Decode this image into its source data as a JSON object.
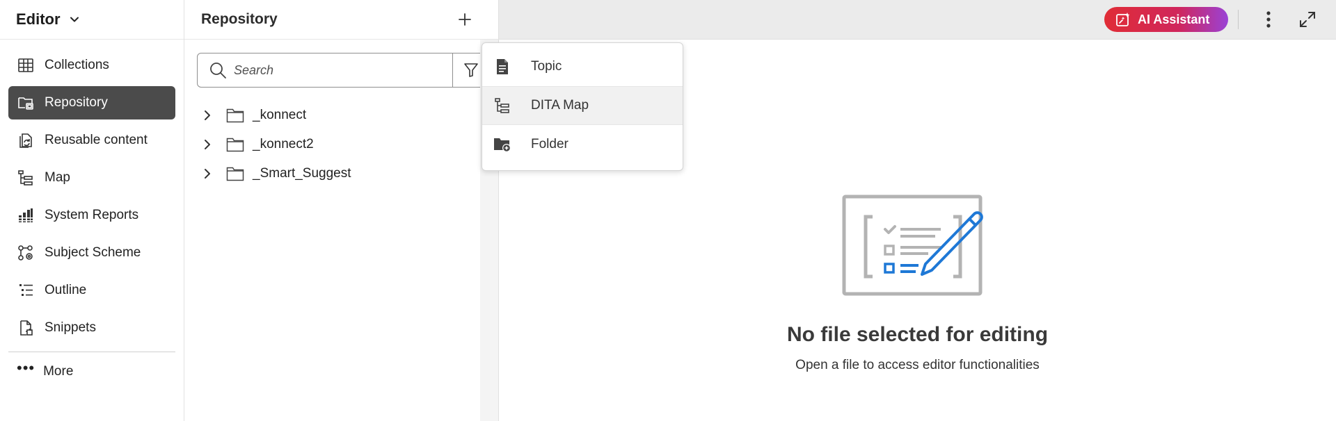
{
  "sidebar": {
    "title": "Editor",
    "items": [
      {
        "label": "Collections",
        "icon": "grid-icon",
        "active": false
      },
      {
        "label": "Repository",
        "icon": "repository-icon",
        "active": true
      },
      {
        "label": "Reusable content",
        "icon": "reusable-content-icon",
        "active": false
      },
      {
        "label": "Map",
        "icon": "map-tree-icon",
        "active": false
      },
      {
        "label": "System Reports",
        "icon": "reports-icon",
        "active": false
      },
      {
        "label": "Subject Scheme",
        "icon": "subject-scheme-icon",
        "active": false
      },
      {
        "label": "Outline",
        "icon": "outline-icon",
        "active": false
      },
      {
        "label": "Snippets",
        "icon": "snippets-icon",
        "active": false
      }
    ],
    "more_label": "More"
  },
  "repository": {
    "title": "Repository",
    "search": {
      "placeholder": "Search",
      "value": ""
    },
    "tree": [
      {
        "label": "_konnect"
      },
      {
        "label": "_konnect2"
      },
      {
        "label": "_Smart_Suggest"
      }
    ]
  },
  "new_menu": {
    "items": [
      {
        "label": "Topic",
        "icon": "topic-file-icon"
      },
      {
        "label": "DITA Map",
        "icon": "dita-map-icon"
      },
      {
        "label": "Folder",
        "icon": "new-folder-icon"
      }
    ]
  },
  "topbar": {
    "ai_assistant_label": "AI Assistant"
  },
  "main": {
    "empty_title": "No file selected for editing",
    "empty_subtitle": "Open a file to access editor functionalities"
  },
  "colors": {
    "accent_active": "#4b4b4b",
    "ai_gradient_start": "#e02d36",
    "ai_gradient_end": "#9a42d6",
    "illustration_blue": "#1e78d6"
  }
}
